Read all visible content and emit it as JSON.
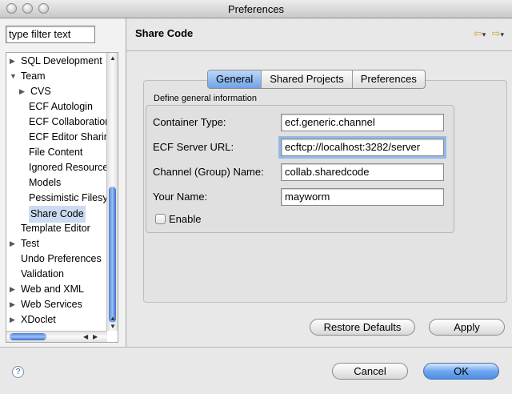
{
  "window": {
    "title": "Preferences"
  },
  "filter": {
    "value": "type filter text"
  },
  "tree": {
    "items": [
      {
        "label": "SQL Development",
        "arrow": "▶",
        "indent": 0
      },
      {
        "label": "Team",
        "arrow": "▼",
        "indent": 0
      },
      {
        "label": "CVS",
        "arrow": "▶",
        "indent": 1
      },
      {
        "label": "ECF Autologin",
        "arrow": "",
        "indent": 2
      },
      {
        "label": "ECF Collaboration",
        "arrow": "",
        "indent": 2
      },
      {
        "label": "ECF Editor Sharing",
        "arrow": "",
        "indent": 2
      },
      {
        "label": "File Content",
        "arrow": "",
        "indent": 2
      },
      {
        "label": "Ignored Resources",
        "arrow": "",
        "indent": 2
      },
      {
        "label": "Models",
        "arrow": "",
        "indent": 2
      },
      {
        "label": "Pessimistic Filesystem",
        "arrow": "",
        "indent": 2
      },
      {
        "label": "Share Code",
        "arrow": "",
        "indent": 2,
        "selected": true
      },
      {
        "label": "Template Editor",
        "arrow": "",
        "indent": 0
      },
      {
        "label": "Test",
        "arrow": "▶",
        "indent": 0
      },
      {
        "label": "Undo Preferences",
        "arrow": "",
        "indent": 0
      },
      {
        "label": "Validation",
        "arrow": "",
        "indent": 0
      },
      {
        "label": "Web and XML",
        "arrow": "▶",
        "indent": 0
      },
      {
        "label": "Web Services",
        "arrow": "▶",
        "indent": 0
      },
      {
        "label": "XDoclet",
        "arrow": "▶",
        "indent": 0
      }
    ]
  },
  "page": {
    "title": "Share Code"
  },
  "tabs": [
    "General",
    "Shared Projects",
    "Preferences"
  ],
  "section": {
    "legend": "Define general information"
  },
  "form": {
    "container_type_label": "Container Type:",
    "container_type_value": "ecf.generic.channel",
    "server_url_label": "ECF Server URL:",
    "server_url_value": "ecftcp://localhost:3282/server",
    "channel_label": "Channel (Group) Name:",
    "channel_value": "collab.sharedcode",
    "your_name_label": "Your Name:",
    "your_name_value": "mayworm",
    "enable_label": "Enable"
  },
  "buttons": {
    "restore_defaults": "Restore Defaults",
    "apply": "Apply",
    "cancel": "Cancel",
    "ok": "OK"
  },
  "icons": {
    "help": "?",
    "back": "⇦",
    "forward": "⇨",
    "dropdown": "▾"
  }
}
